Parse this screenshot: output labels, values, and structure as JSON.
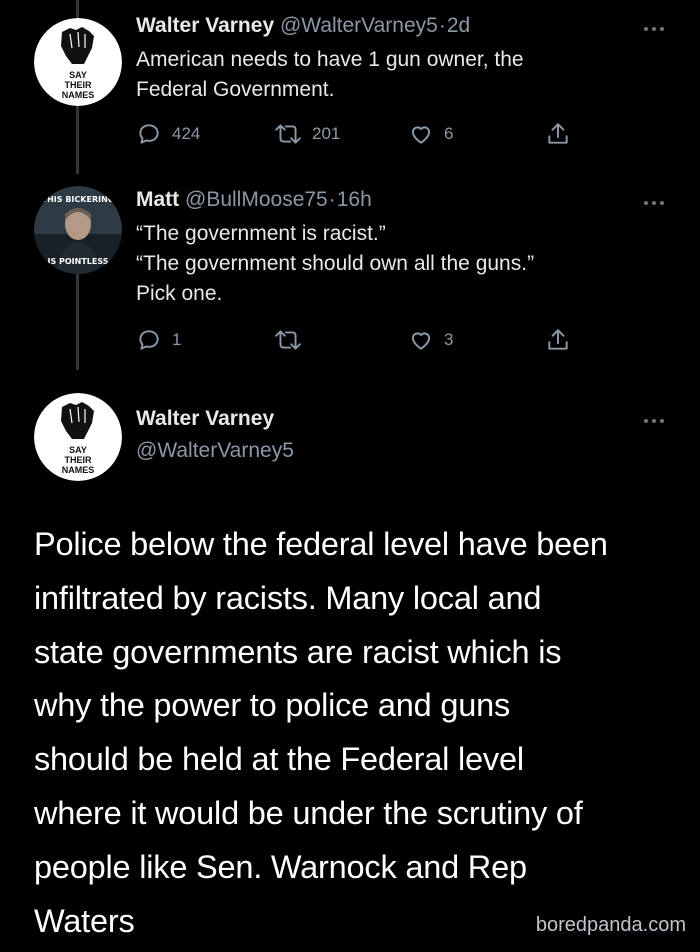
{
  "tweets": [
    {
      "name": "Walter Varney",
      "handle": "@WalterVarney5",
      "time": "2d",
      "text_lines": [
        "American needs to have 1 gun owner, the",
        "Federal Government."
      ],
      "avatar": {
        "icon": "raised-fist-icon",
        "caption_lines": [
          "SAY",
          "THEIR",
          "NAMES"
        ]
      },
      "replies": "424",
      "retweets": "201",
      "likes": "6"
    },
    {
      "name": "Matt",
      "handle": "@BullMoose75",
      "time": "16h",
      "text_lines": [
        "“The government is racist.”",
        "“The government should own all the guns.”",
        "Pick one."
      ],
      "avatar": {
        "icon": "portrait-meme-icon",
        "caption_lines": [
          "THIS BICKERING",
          "IS POINTLESS"
        ]
      },
      "replies": "1",
      "retweets": "",
      "likes": "3"
    }
  ],
  "main_tweet": {
    "name": "Walter Varney",
    "handle": "@WalterVarney5",
    "avatar": {
      "icon": "raised-fist-icon",
      "caption_lines": [
        "SAY",
        "THEIR",
        "NAMES"
      ]
    },
    "text_lines": [
      "Police below the federal level have been",
      "infiltrated by racists. Many local and",
      "state governments are racist which is",
      "why the power to police and guns",
      "should be held at the Federal level",
      "where it would be under the scrutiny of",
      "people like Sen. Warnock and Rep",
      "Waters"
    ]
  },
  "watermark": "boredpanda.com",
  "colors": {
    "background": "#000000",
    "primary_text": "#e7e9ea",
    "secondary_text": "#8b98a5",
    "thread_line": "#333639"
  }
}
